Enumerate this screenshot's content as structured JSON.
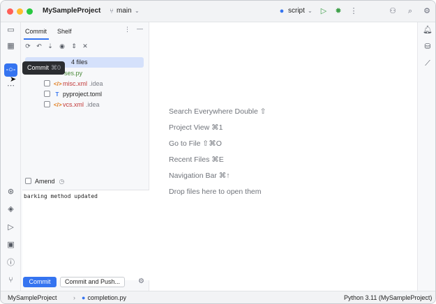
{
  "titlebar": {
    "project": "MySampleProject",
    "branch": "main",
    "run_config": "script"
  },
  "commit_panel": {
    "tabs": [
      "Commit",
      "Shelf"
    ],
    "changes_label": "4 files",
    "files": [
      {
        "name": "ses.py",
        "path": "",
        "color": "green",
        "icon": "python-icon"
      },
      {
        "name": "misc.xml",
        "path": ".idea",
        "color": "red",
        "icon": "xml-file-icon"
      },
      {
        "name": "pyproject.toml",
        "path": "",
        "color": "normal",
        "icon": "toml-file-icon"
      },
      {
        "name": "vcs.xml",
        "path": ".idea",
        "color": "red",
        "icon": "xml-file-icon"
      }
    ],
    "amend_label": "Amend",
    "message": "barking method updated",
    "commit_button": "Commit",
    "commit_push_button": "Commit and Push..."
  },
  "tooltip": {
    "label": "Commit",
    "shortcut": "⌘0"
  },
  "editor_hints": [
    "Search Everywhere Double ⇧",
    "Project View ⌘1",
    "Go to File ⇧⌘O",
    "Recent Files ⌘E",
    "Navigation Bar ⌘↑",
    "Drop files here to open them"
  ],
  "statusbar": {
    "project": "MySampleProject",
    "file": "completion.py",
    "interpreter": "Python 3.11 (MySampleProject)"
  },
  "colors": {
    "accent": "#3574f0",
    "modified_file": "#c23a3a",
    "added_file": "#4b8a3a"
  }
}
